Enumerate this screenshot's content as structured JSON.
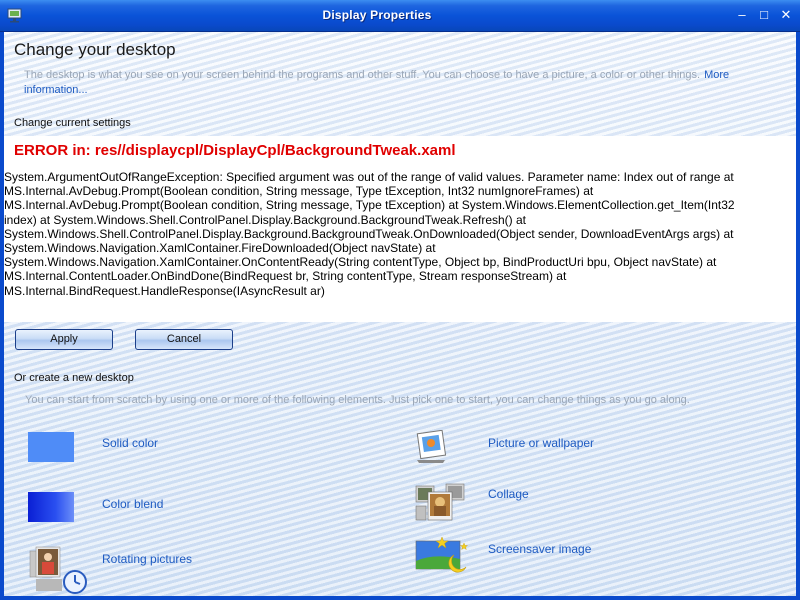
{
  "window": {
    "title": "Display Properties",
    "minimize_glyph": "–",
    "maximize_glyph": "□",
    "close_glyph": "✕"
  },
  "header": {
    "heading": "Change your desktop",
    "description": "The desktop is what you see on your screen behind the programs and other stuff. You can choose to have a picture, a color or other things.",
    "more_link": "More information..."
  },
  "current": {
    "section_title": "Change current settings",
    "error_title": "ERROR in: res//displaycpl/DisplayCpl/BackgroundTweak.xaml",
    "error_body": "System.ArgumentOutOfRangeException: Specified argument was out of the range of valid values. Parameter name: Index out of range    at MS.Internal.AvDebug.Prompt(Boolean condition, String message, Type tException, Int32 numIgnoreFrames)    at MS.Internal.AvDebug.Prompt(Boolean condition, String message, Type tException)    at System.Windows.ElementCollection.get_Item(Int32 index)    at System.Windows.Shell.ControlPanel.Display.Background.BackgroundTweak.Refresh()    at System.Windows.Shell.ControlPanel.Display.Background.BackgroundTweak.OnDownloaded(Object sender, DownloadEventArgs args)    at System.Windows.Navigation.XamlContainer.FireDownloaded(Object navState)    at System.Windows.Navigation.XamlContainer.OnContentReady(String contentType, Object bp, BindProductUri bpu, Object navState)    at MS.Internal.ContentLoader.OnBindDone(BindRequest br, String contentType, Stream responseStream)    at MS.Internal.BindRequest.HandleResponse(IAsyncResult ar)",
    "apply_label": "Apply",
    "cancel_label": "Cancel"
  },
  "create": {
    "section_title": "Or create a new desktop",
    "description": "You can start from scratch by using one or more of the following elements. Just pick one to start, you can change things as you go along.",
    "elements": {
      "solid_color": {
        "label": "Solid color",
        "icon": "solid-color-swatch"
      },
      "color_blend": {
        "label": "Color blend",
        "icon": "color-blend-swatch"
      },
      "rotating_pictures": {
        "label": "Rotating pictures",
        "icon": "rotating-pictures-icon"
      },
      "picture_or_wallpaper": {
        "label": "Picture or wallpaper",
        "icon": "picture-frame-icon"
      },
      "collage": {
        "label": "Collage",
        "icon": "collage-photos-icon"
      },
      "screensaver_image": {
        "label": "Screensaver image",
        "icon": "moon-stars-landscape-icon"
      }
    }
  },
  "colors": {
    "titlebar": "#0a53d8",
    "error_red": "#e00000",
    "link_blue": "#1e5bc2",
    "solid_swatch": "#4f8cf7",
    "blend_start": "#0a1fd4",
    "blend_end": "#6c8ff8"
  }
}
